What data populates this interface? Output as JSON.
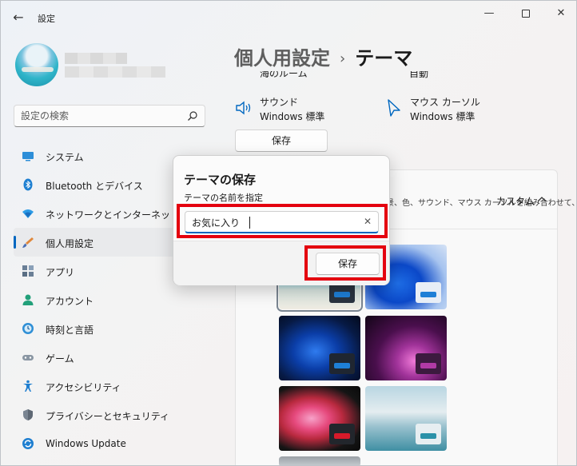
{
  "window": {
    "title": "設定",
    "back_glyph": "←",
    "minimize_glyph": "—",
    "close_glyph": "✕"
  },
  "search": {
    "placeholder": "設定の検索"
  },
  "nav": {
    "items": [
      {
        "label": "システム"
      },
      {
        "label": "Bluetooth とデバイス"
      },
      {
        "label": "ネットワークとインターネット"
      },
      {
        "label": "個人用設定"
      },
      {
        "label": "アプリ"
      },
      {
        "label": "アカウント"
      },
      {
        "label": "時刻と言語"
      },
      {
        "label": "ゲーム"
      },
      {
        "label": "アクセシビリティ"
      },
      {
        "label": "プライバシーとセキュリティ"
      },
      {
        "label": "Windows Update"
      }
    ]
  },
  "breadcrumb": {
    "parent": "個人用設定",
    "separator": "›",
    "current": "テーマ"
  },
  "props": {
    "partial_left": "海のルーム",
    "partial_right": "自動",
    "sound": {
      "name": "サウンド",
      "value": "Windows 標準"
    },
    "cursor": {
      "name": "マウス カーソル",
      "value": "Windows 標準"
    },
    "save_label": "保存"
  },
  "theme_panel": {
    "description": "背景、色、サウンド、マウス カーソルを組み合わせて、デスクトップをもっと",
    "current_theme": "カスタム"
  },
  "dialog": {
    "title": "テーマの保存",
    "label": "テーマの名前を指定",
    "input_value": "お気に入り",
    "clear_glyph": "✕",
    "save_label": "保存"
  },
  "colors": {
    "accent": "#0067c0",
    "highlight": "#e4000f"
  }
}
